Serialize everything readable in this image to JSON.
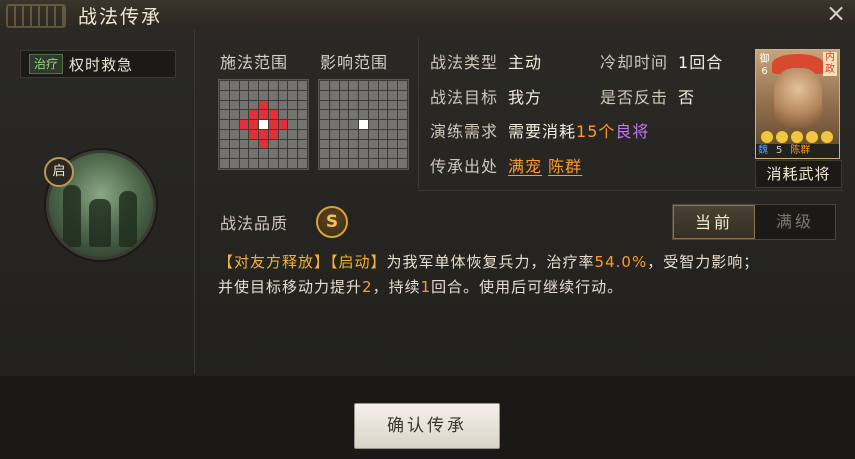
{
  "title": "战法传承",
  "close_label": "×",
  "skill": {
    "type_tag": "治疗",
    "name": "权时救急",
    "qi_badge": "启"
  },
  "ranges": {
    "cast_label": "施法范围",
    "effect_label": "影响范围"
  },
  "info": {
    "tactic_type_key": "战法类型",
    "tactic_type_val": "主动",
    "cooldown_key": "冷却时间",
    "cooldown_val": "1回合",
    "target_key": "战法目标",
    "target_val": "我方",
    "counter_key": "是否反击",
    "counter_val": "否",
    "train_key": "演练需求",
    "train_val_pre": "需要消耗",
    "train_val_num": "15个",
    "train_val_item": "良将",
    "source_key": "传承出处",
    "source_a": "满宠",
    "source_b": "陈群"
  },
  "card": {
    "side_label": "御",
    "side_num": "6",
    "tag": "内政",
    "faction": "魏",
    "level": "5",
    "name": "陈群",
    "caption": "消耗武将"
  },
  "quality": {
    "label": "战法品质",
    "grade": "S"
  },
  "toggle": {
    "current": "当前",
    "max": "满级"
  },
  "description": {
    "tag1": "【对友方释放】",
    "tag2": "【启动】",
    "line1_rest": "为我军单体恢复兵力，治疗率",
    "rate": "54.0%",
    "line1_end": "，受智力影响；",
    "line2_pre": "并使目标移动力提升",
    "move": "2",
    "line2_mid": "，持续",
    "turns": "1",
    "line2_end": "回合。使用后可继续行动。"
  },
  "confirm_button": "确认传承"
}
